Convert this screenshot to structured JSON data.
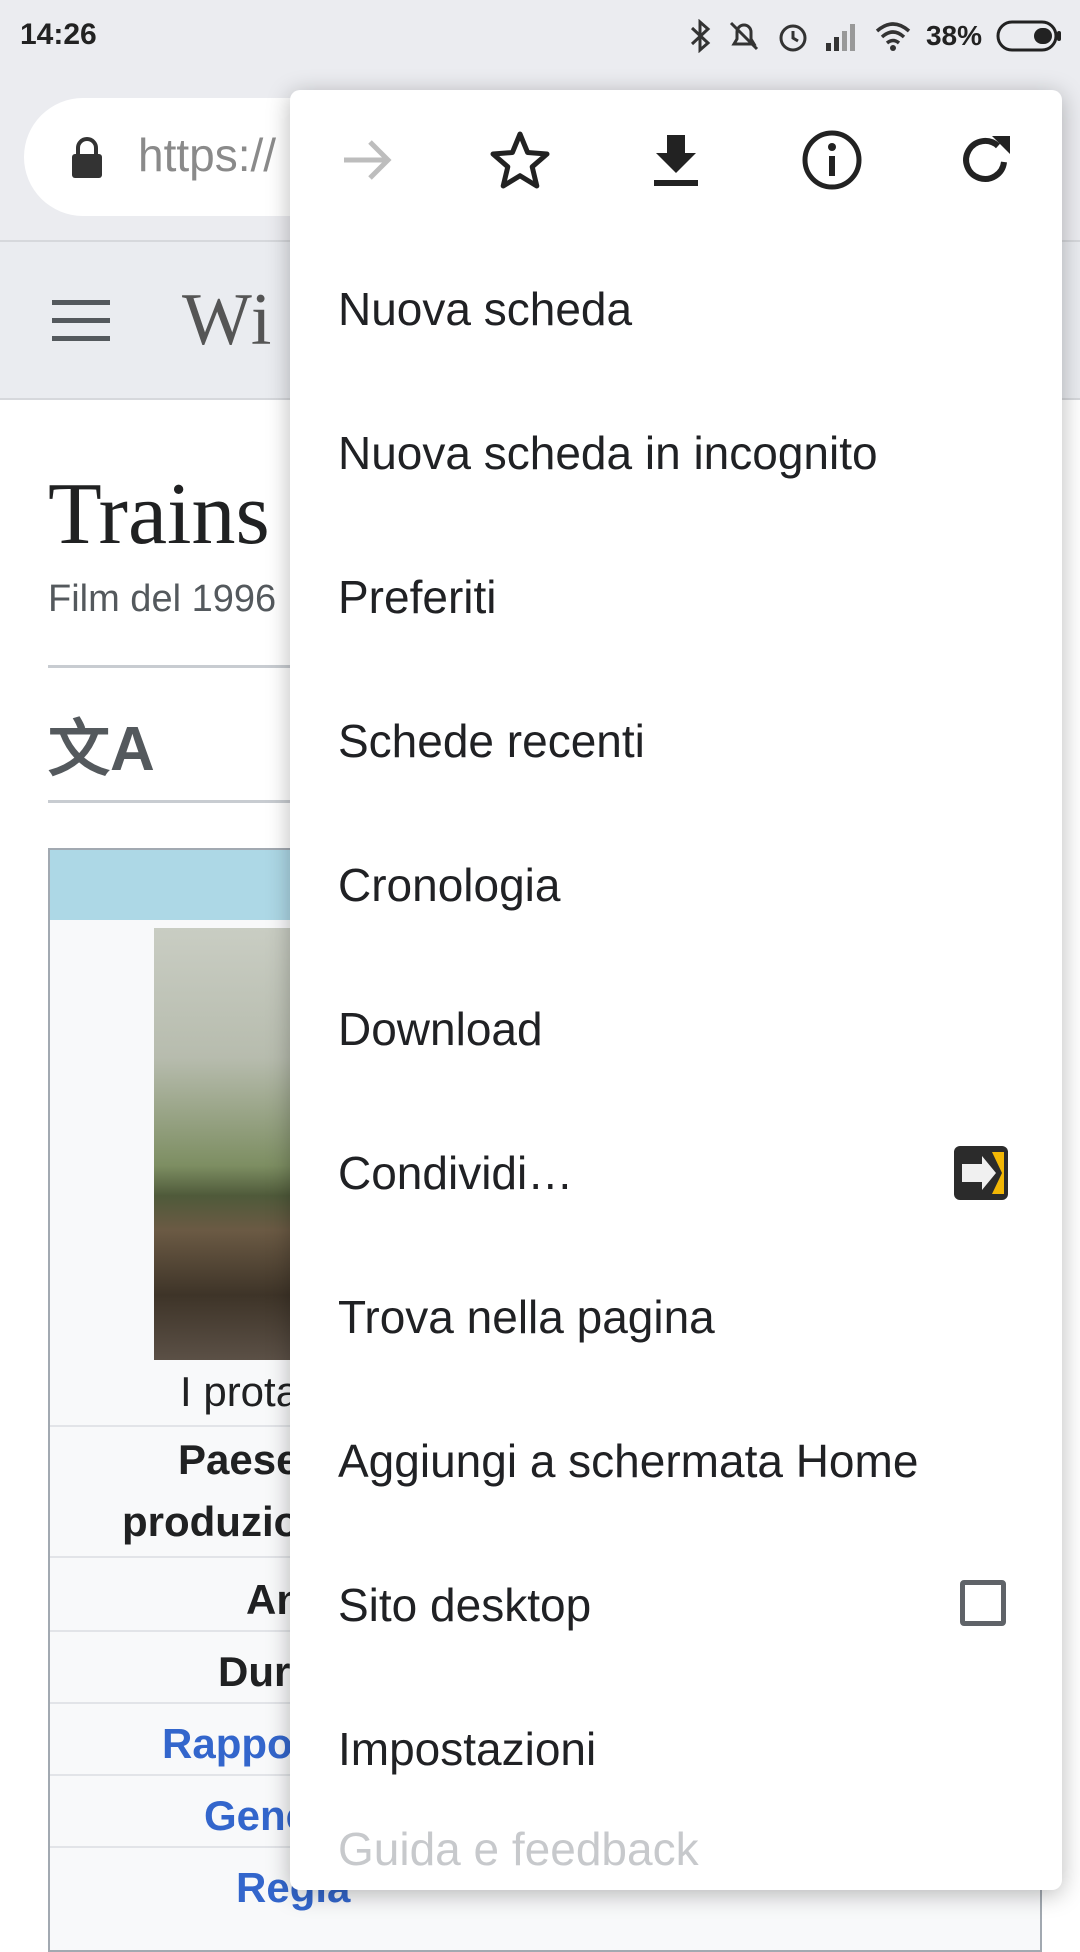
{
  "status_bar": {
    "time": "14:26",
    "battery": "38%"
  },
  "toolbar": {
    "url": "https://"
  },
  "wiki": {
    "logo": "Wi"
  },
  "article": {
    "title": "Trains",
    "subtitle": "Film del 1996",
    "lang_icon": "文A",
    "caption": "I prota",
    "rows": [
      {
        "label": "Paese"
      },
      {
        "label": "produzio"
      },
      {
        "label": "An"
      },
      {
        "label": "Dur"
      },
      {
        "link": "Rappo"
      },
      {
        "link": "Gene"
      },
      {
        "link": "Regia"
      }
    ]
  },
  "menu": {
    "top_icons": [
      "forward-icon",
      "star-icon",
      "download-icon",
      "info-icon",
      "refresh-icon"
    ],
    "items": [
      {
        "label": "Nuova scheda"
      },
      {
        "label": "Nuova scheda in incognito"
      },
      {
        "label": "Preferiti"
      },
      {
        "label": "Schede recenti"
      },
      {
        "label": "Cronologia"
      },
      {
        "label": "Download"
      },
      {
        "label": "Condividi…"
      },
      {
        "label": "Trova nella pagina"
      },
      {
        "label": "Aggiungi a schermata Home"
      },
      {
        "label": "Sito desktop"
      },
      {
        "label": "Impostazioni"
      },
      {
        "label": "Guida e feedback"
      }
    ],
    "desktop_site_checked": false
  },
  "colors": {
    "link": "#3366cc",
    "toolbar_bg": "#ebecf0",
    "infobox_header": "#add8e6"
  }
}
